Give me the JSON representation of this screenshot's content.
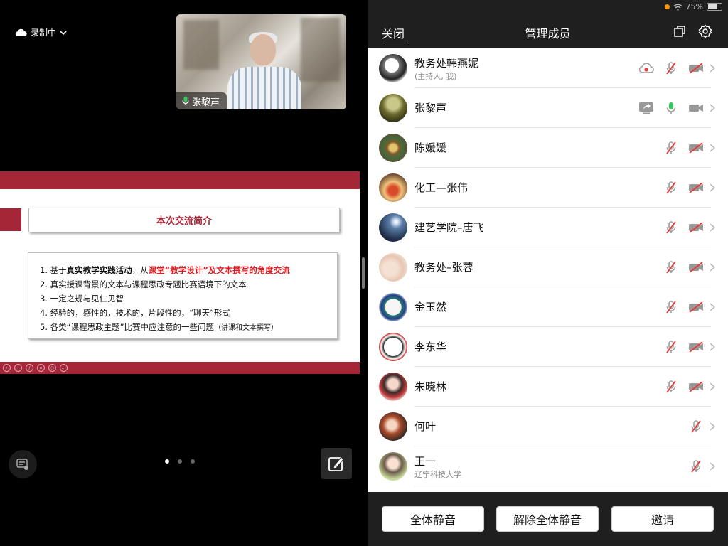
{
  "recording": {
    "label": "录制中"
  },
  "video": {
    "name": "张黎声"
  },
  "slide": {
    "title": "本次交流简介",
    "items": [
      {
        "num": "1.",
        "pre": "基于",
        "bold": "真实教学实践活动",
        "mid": "，从",
        "red": "课堂“教学设计”及文本撰写的角度交流"
      },
      {
        "num": "2.",
        "text": "真实授课背景的文本与课程思政专题比赛语境下的文本"
      },
      {
        "num": "3.",
        "text": "一定之规与见仁见智"
      },
      {
        "num": "4.",
        "text": "经验的，感性的，技术的，片段性的，“聊天”形式"
      },
      {
        "num": "5.",
        "text": "各类“课程思政主题”比赛中应注意的一些问题",
        "small": "（讲课和文本撰写）"
      }
    ]
  },
  "pager": {
    "total": 3,
    "active": 0
  },
  "status": {
    "battery": "75%"
  },
  "panel": {
    "close": "关闭",
    "title": "管理成员",
    "members": [
      {
        "name": "教务处韩燕妮",
        "sub": "(主持人, 我)",
        "icons": [
          "cloud-record-icon",
          "mic-muted-icon",
          "camera-off-icon"
        ]
      },
      {
        "name": "张黎声",
        "icons": [
          "screen-share-icon",
          "mic-active-icon",
          "camera-on-icon"
        ]
      },
      {
        "name": "陈媛媛",
        "icons": [
          "mic-muted-icon",
          "camera-off-icon"
        ]
      },
      {
        "name": "化工—张伟",
        "icons": [
          "mic-muted-icon",
          "camera-off-icon"
        ]
      },
      {
        "name": "建艺学院–唐飞",
        "icons": [
          "mic-muted-icon",
          "camera-off-icon"
        ]
      },
      {
        "name": "教务处–张蓉",
        "icons": [
          "mic-muted-icon",
          "camera-off-icon"
        ]
      },
      {
        "name": "金玉然",
        "icons": [
          "mic-muted-icon",
          "camera-off-icon"
        ]
      },
      {
        "name": "李东华",
        "icons": [
          "mic-muted-icon",
          "camera-off-icon"
        ]
      },
      {
        "name": "朱晓林",
        "icons": [
          "mic-muted-icon",
          "camera-off-icon"
        ]
      },
      {
        "name": "何叶",
        "icons": [
          "mic-muted-icon"
        ]
      },
      {
        "name": "王一",
        "sub": "辽宁科技大学",
        "icons": [
          "mic-muted-icon"
        ]
      }
    ],
    "buttons": {
      "mute_all": "全体静音",
      "unmute_all": "解除全体静音",
      "invite": "邀请"
    }
  },
  "colors": {
    "accent_red": "#a52737",
    "highlight_red": "#e0191f",
    "mic_green": "#34c759",
    "muted_red": "#e53935"
  }
}
